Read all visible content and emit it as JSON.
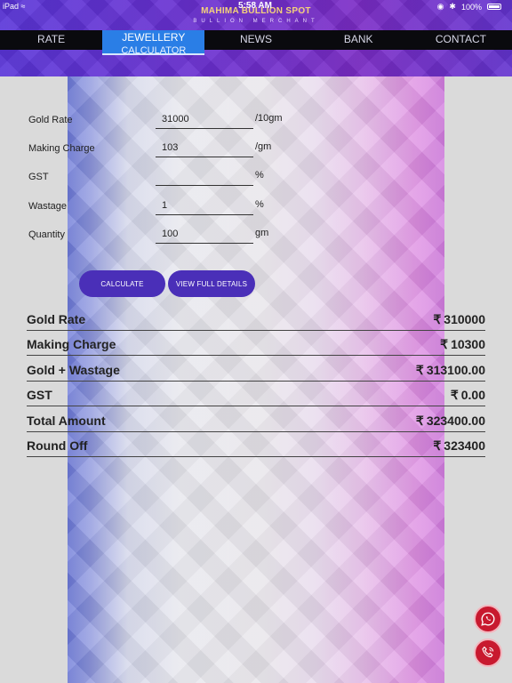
{
  "status_bar": {
    "device": "iPad",
    "time": "5:58 AM",
    "battery": "100%"
  },
  "brand": {
    "name": "MAHIMA BULLION SPOT",
    "subtitle": "BULLION MERCHANT"
  },
  "nav": {
    "items": [
      {
        "label": "RATE"
      },
      {
        "label_line1": "JEWELLERY",
        "label_line2": "CALCULATOR"
      },
      {
        "label": "NEWS"
      },
      {
        "label": "BANK"
      },
      {
        "label": "CONTACT"
      }
    ],
    "active_index": 1
  },
  "form": {
    "gold_rate": {
      "label": "Gold Rate",
      "value": "31000",
      "unit": "/10gm"
    },
    "making_charge": {
      "label": "Making Charge",
      "value": "103",
      "unit": "/gm"
    },
    "gst": {
      "label": "GST",
      "value": "",
      "unit": "%"
    },
    "wastage": {
      "label": "Wastage",
      "value": "1",
      "unit": "%"
    },
    "quantity": {
      "label": "Quantity",
      "value": "100",
      "unit": "gm"
    }
  },
  "buttons": {
    "calculate": "CALCULATE",
    "view_full_details": "VIEW FULL DETAILS"
  },
  "currency_symbol": "₹",
  "results": [
    {
      "label": "Gold Rate",
      "value": "310000"
    },
    {
      "label": "Making Charge",
      "value": "10300"
    },
    {
      "label": "Gold + Wastage",
      "value": "313100.00"
    },
    {
      "label": "GST",
      "value": "0.00"
    },
    {
      "label": "Total Amount",
      "value": "323400.00"
    },
    {
      "label": "Round Off",
      "value": "323400"
    }
  ],
  "fab": {
    "whatsapp_icon": "whatsapp-icon",
    "phone_icon": "phone-icon"
  },
  "colors": {
    "header_purple": "#6a2fd0",
    "active_tab": "#2a7ee6",
    "button_purple": "#4a2fb8",
    "brand_gold": "#f4d27a",
    "fab_red": "#c8192f"
  }
}
